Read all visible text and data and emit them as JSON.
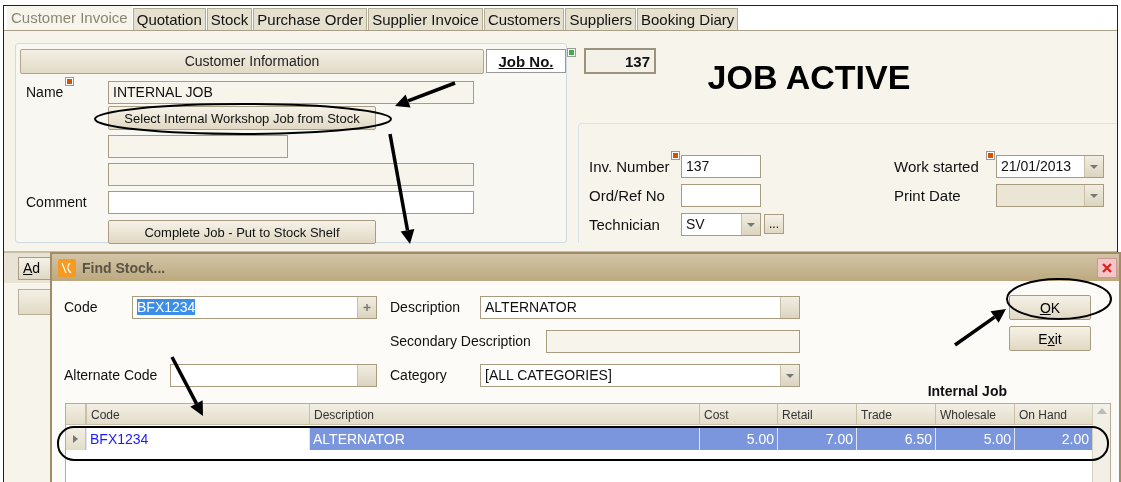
{
  "tabs": [
    {
      "label": "Customer Invoice",
      "selected": true
    },
    {
      "label": "Quotation",
      "selected": false
    },
    {
      "label": "Stock",
      "selected": false
    },
    {
      "label": "Purchase Order",
      "selected": false
    },
    {
      "label": "Supplier Invoice",
      "selected": false
    },
    {
      "label": "Customers",
      "selected": false
    },
    {
      "label": "Suppliers",
      "selected": false
    },
    {
      "label": "Booking Diary",
      "selected": false
    }
  ],
  "customer_panel": {
    "header": "Customer Information",
    "name_label": "Name",
    "name_required": true,
    "name_value": "INTERNAL JOB",
    "select_button": "Select Internal Workshop Job from Stock",
    "comment_label": "Comment",
    "complete_button": "Complete Job - Put to Stock Shelf"
  },
  "job": {
    "label": "Job No.",
    "value": "137",
    "status": "JOB ACTIVE"
  },
  "invoice_panel": {
    "left_fields": [
      {
        "label": "Inv. Number",
        "value": "137",
        "kind": "text",
        "required": true
      },
      {
        "label": "Ord/Ref No",
        "kind": "text"
      },
      {
        "label": "Technician",
        "value": "SV",
        "kind": "combo",
        "browse_label": "..."
      }
    ],
    "right_fields": [
      {
        "label": "Work started",
        "value": "21/01/2013",
        "kind": "combo",
        "required": true,
        "disabled": false
      },
      {
        "label": "Print Date",
        "kind": "combo",
        "disabled": true
      }
    ]
  },
  "add_button": {
    "key": "A",
    "after": "d"
  },
  "dialog": {
    "title": "Find Stock...",
    "code_label": "Code",
    "code_value": "BFX1234",
    "description_label": "Description",
    "description_value": "ALTERNATOR",
    "secondary_label": "Secondary Description",
    "alternate_label": "Alternate Code",
    "category_label": "Category",
    "category_value": "[ALL CATEGORIES]",
    "buttons": [
      {
        "key": "O",
        "after": "K"
      },
      {
        "before": "E",
        "key": "x",
        "after": "it"
      }
    ],
    "grid_caption": "Internal Job",
    "table": {
      "columns": [
        "Code",
        "Description",
        "Cost",
        "Retail",
        "Trade",
        "Wholesale",
        "On Hand"
      ],
      "rows": [
        {
          "cells": [
            "BFX1234",
            "ALTERNATOR",
            "5.00",
            "7.00",
            "6.50",
            "5.00",
            "2.00"
          ],
          "selected": true
        }
      ]
    }
  }
}
